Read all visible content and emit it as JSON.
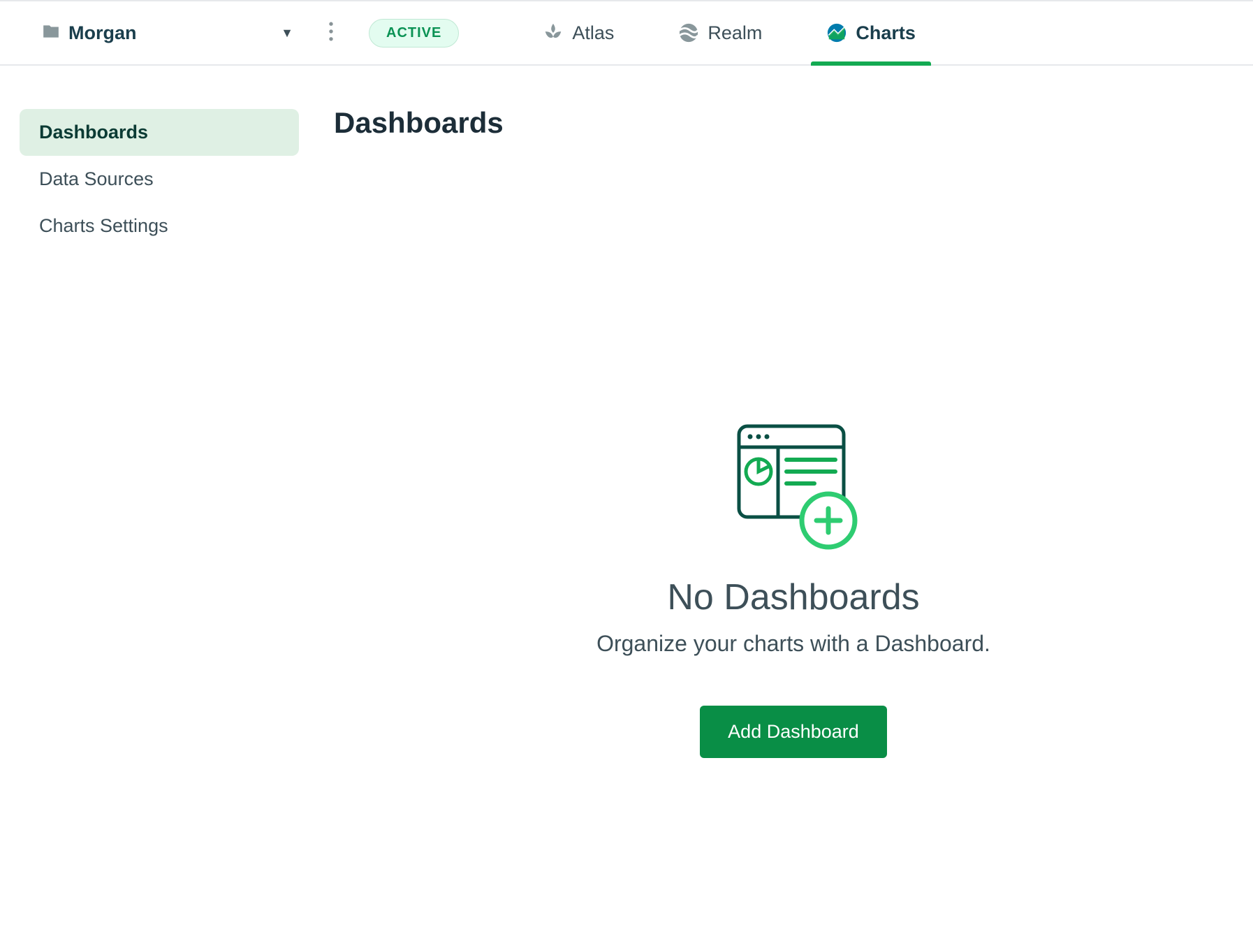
{
  "header": {
    "project_name": "Morgan",
    "status_label": "ACTIVE",
    "tabs": [
      {
        "label": "Atlas"
      },
      {
        "label": "Realm"
      },
      {
        "label": "Charts"
      }
    ]
  },
  "sidebar": {
    "items": [
      {
        "label": "Dashboards"
      },
      {
        "label": "Data Sources"
      },
      {
        "label": "Charts Settings"
      }
    ]
  },
  "main": {
    "page_title": "Dashboards",
    "empty_state": {
      "title": "No Dashboards",
      "subtitle": "Organize your charts with a Dashboard.",
      "button_label": "Add Dashboard"
    }
  }
}
